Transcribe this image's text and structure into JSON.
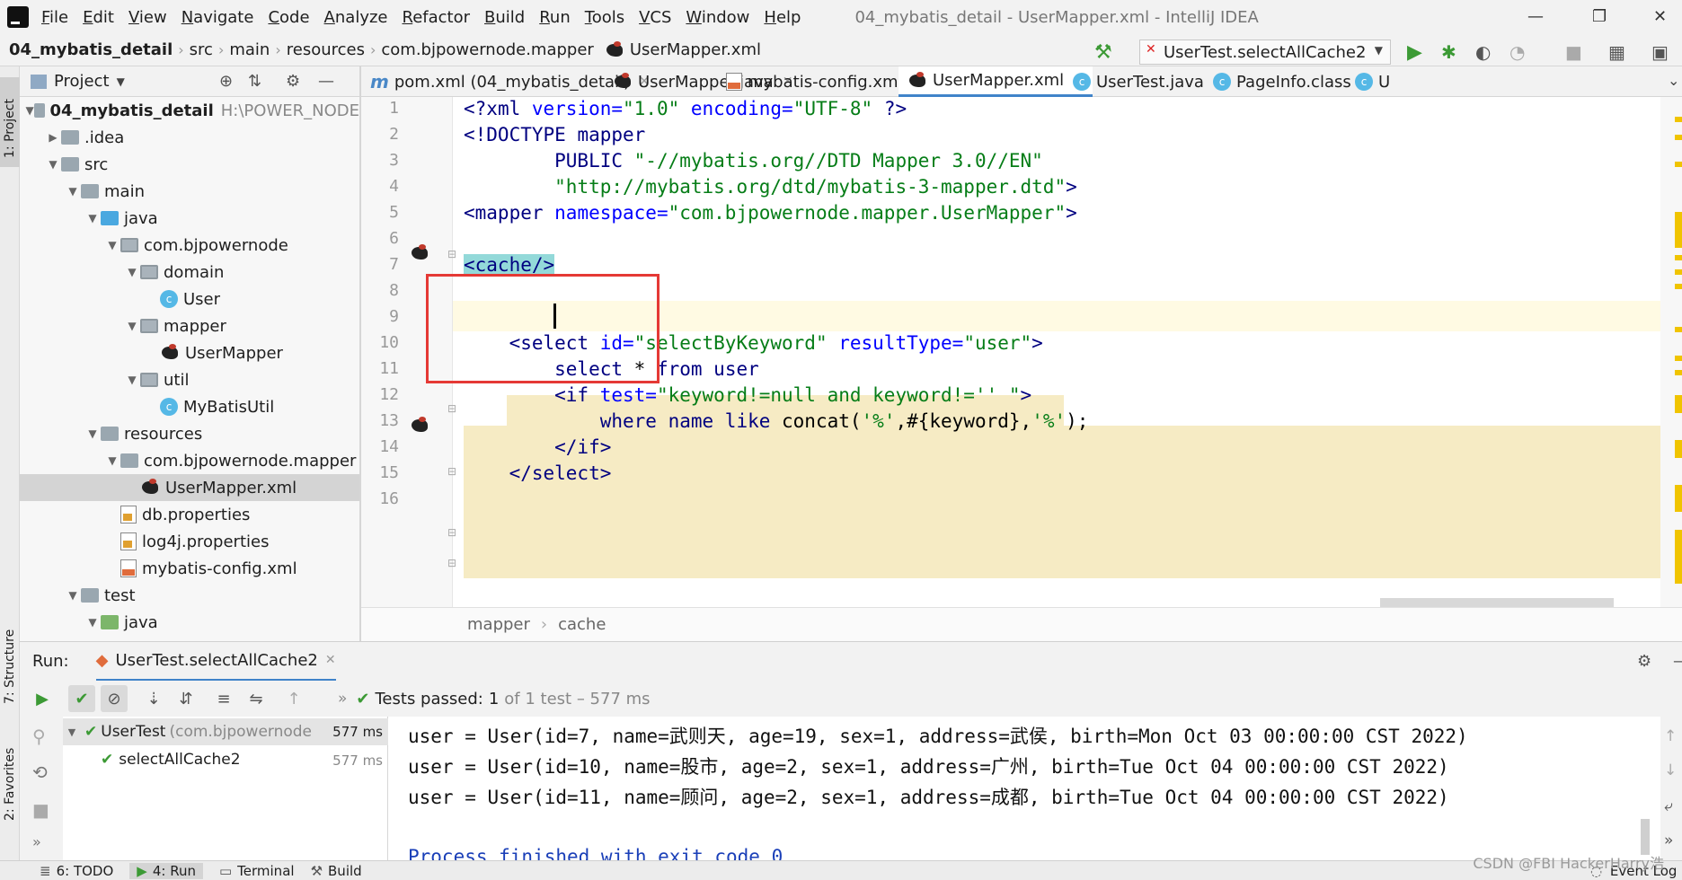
{
  "menubar": {
    "items": [
      "File",
      "Edit",
      "View",
      "Navigate",
      "Code",
      "Analyze",
      "Refactor",
      "Build",
      "Run",
      "Tools",
      "VCS",
      "Window",
      "Help"
    ],
    "window_title": "04_mybatis_detail - UserMapper.xml - IntelliJ IDEA",
    "controls": [
      "—",
      "❐",
      "✕"
    ]
  },
  "navbar": {
    "crumbs": [
      "04_mybatis_detail",
      "src",
      "main",
      "resources",
      "com.bjpowernode.mapper",
      "UserMapper.xml"
    ],
    "run_config": "UserTest.selectAllCache2"
  },
  "left_stripe": {
    "project": "1: Project",
    "structure": "7: Structure",
    "favorites": "2: Favorites"
  },
  "project_panel": {
    "title": "Project",
    "tree": [
      {
        "label": "04_mybatis_detail",
        "extra": "H:\\POWER_NODE",
        "depth": 0,
        "arrow": "▼",
        "icon": "folder"
      },
      {
        "label": ".idea",
        "depth": 1,
        "arrow": "▶",
        "icon": "folder"
      },
      {
        "label": "src",
        "depth": 1,
        "arrow": "▼",
        "icon": "folder"
      },
      {
        "label": "main",
        "depth": 2,
        "arrow": "▼",
        "icon": "folder"
      },
      {
        "label": "java",
        "depth": 3,
        "arrow": "▼",
        "icon": "folder-blue"
      },
      {
        "label": "com.bjpowernode",
        "depth": 4,
        "arrow": "▼",
        "icon": "package"
      },
      {
        "label": "domain",
        "depth": 5,
        "arrow": "▼",
        "icon": "package"
      },
      {
        "label": "User",
        "depth": 6,
        "arrow": "",
        "icon": "class"
      },
      {
        "label": "mapper",
        "depth": 5,
        "arrow": "▼",
        "icon": "package"
      },
      {
        "label": "UserMapper",
        "depth": 6,
        "arrow": "",
        "icon": "mybatis"
      },
      {
        "label": "util",
        "depth": 5,
        "arrow": "▼",
        "icon": "package"
      },
      {
        "label": "MyBatisUtil",
        "depth": 6,
        "arrow": "",
        "icon": "class"
      },
      {
        "label": "resources",
        "depth": 3,
        "arrow": "▼",
        "icon": "folder"
      },
      {
        "label": "com.bjpowernode.mapper",
        "depth": 4,
        "arrow": "▼",
        "icon": "folder"
      },
      {
        "label": "UserMapper.xml",
        "depth": 5,
        "arrow": "",
        "icon": "mybatis",
        "selected": true
      },
      {
        "label": "db.properties",
        "depth": 4,
        "arrow": "",
        "icon": "properties"
      },
      {
        "label": "log4j.properties",
        "depth": 4,
        "arrow": "",
        "icon": "properties"
      },
      {
        "label": "mybatis-config.xml",
        "depth": 4,
        "arrow": "",
        "icon": "xml"
      },
      {
        "label": "test",
        "depth": 2,
        "arrow": "▼",
        "icon": "folder"
      },
      {
        "label": "java",
        "depth": 3,
        "arrow": "▼",
        "icon": "folder-green"
      }
    ]
  },
  "editor_tabs": [
    {
      "label": "pom.xml (04_mybatis_detail)",
      "icon": "maven"
    },
    {
      "label": "UserMapper.java",
      "icon": "mybatis"
    },
    {
      "label": "mybatis-config.xml",
      "icon": "xml"
    },
    {
      "label": "UserMapper.xml",
      "icon": "mybatis",
      "active": true
    },
    {
      "label": "UserTest.java",
      "icon": "class"
    },
    {
      "label": "PageInfo.class",
      "icon": "class"
    },
    {
      "label": "U",
      "icon": "class"
    }
  ],
  "editor": {
    "line_numbers": [
      "1",
      "2",
      "3",
      "4",
      "5",
      "6",
      "7",
      "8",
      "9",
      "10",
      "11",
      "12",
      "13",
      "14",
      "15",
      "16"
    ],
    "breadcrumb": [
      "mapper",
      "cache"
    ]
  },
  "code": {
    "l1": [
      [
        "<?",
        "t-tag"
      ],
      [
        "xml ",
        "t-tag"
      ],
      [
        "version=",
        "t-attr"
      ],
      [
        "\"1.0\" ",
        "t-str"
      ],
      [
        "encoding=",
        "t-attr"
      ],
      [
        "\"UTF-8\" ",
        "t-str"
      ],
      [
        "?>",
        "t-tag"
      ]
    ],
    "l2": [
      [
        "<!DOCTYPE ",
        "t-tag"
      ],
      [
        "mapper",
        "t-tag"
      ]
    ],
    "l3": [
      [
        "        PUBLIC ",
        "t-tag"
      ],
      [
        "\"-//mybatis.org//DTD Mapper 3.0//EN\"",
        "t-str"
      ]
    ],
    "l4": [
      [
        "        ",
        ""
      ],
      [
        "\"http://mybatis.org/dtd/mybatis-3-mapper.dtd\"",
        "t-str"
      ],
      [
        ">",
        "t-tag"
      ]
    ],
    "l5": [
      [
        "<mapper ",
        "t-tag"
      ],
      [
        "namespace=",
        "t-attr"
      ],
      [
        "\"com.bjpowernode.mapper.UserMapper\"",
        "t-str"
      ],
      [
        ">",
        "t-tag"
      ]
    ],
    "l7": [
      [
        "<cache/>",
        "t-tag"
      ]
    ],
    "l10": [
      [
        "    <select ",
        "t-tag"
      ],
      [
        "id=",
        "t-attr"
      ],
      [
        "\"selectByKeyword\" ",
        "t-str"
      ],
      [
        "resultType=",
        "t-attr"
      ],
      [
        "\"user\"",
        "t-str"
      ],
      [
        ">",
        "t-tag"
      ]
    ],
    "l11": [
      [
        "        select ",
        "t-key"
      ],
      [
        "* ",
        ""
      ],
      [
        "from ",
        "t-key"
      ],
      [
        "user",
        "t-key"
      ]
    ],
    "l12": [
      [
        "        <if ",
        "t-tag"
      ],
      [
        "test=",
        "t-attr"
      ],
      [
        "\"keyword!=null and keyword!='' \"",
        "t-str"
      ],
      [
        ">",
        "t-tag"
      ]
    ],
    "l13": [
      [
        "            where ",
        "t-key"
      ],
      [
        "name ",
        "t-key"
      ],
      [
        "like ",
        "t-key"
      ],
      [
        "concat(",
        ""
      ],
      [
        "'%'",
        "t-str"
      ],
      [
        ",#{keyword},",
        ""
      ],
      [
        "'%'",
        "t-str"
      ],
      [
        ");",
        ""
      ]
    ],
    "l14": [
      [
        "        </if>",
        "t-tag"
      ]
    ],
    "l15": [
      [
        "    </select>",
        "t-tag"
      ]
    ]
  },
  "run_panel": {
    "label": "Run:",
    "tab": "UserTest.selectAllCache2",
    "status_prefix": "Tests passed:",
    "status_count": "1",
    "status_rest": "of 1 test – 577 ms",
    "tree": [
      {
        "label": "UserTest",
        "extra": "(com.bjpowernode",
        "time": "577 ms"
      },
      {
        "label": "selectAllCache2",
        "time": "577 ms"
      }
    ],
    "console": [
      "user = User(id=7, name=武则天, age=19, sex=1, address=武侯, birth=Mon Oct 03 00:00:00 CST 2022)",
      "user = User(id=10, name=股市, age=2, sex=1, address=广州, birth=Tue Oct 04 00:00:00 CST 2022)",
      "user = User(id=11, name=顾问, age=2, sex=1, address=成都, birth=Tue Oct 04 00:00:00 CST 2022)",
      "Process finished with exit code 0"
    ]
  },
  "bottom_bar": {
    "tabs": [
      "6: TODO",
      "4: Run",
      "Terminal",
      "Build"
    ],
    "event_log": "Event Log",
    "watermark": "CSDN @FBI HackerHarry浩"
  }
}
